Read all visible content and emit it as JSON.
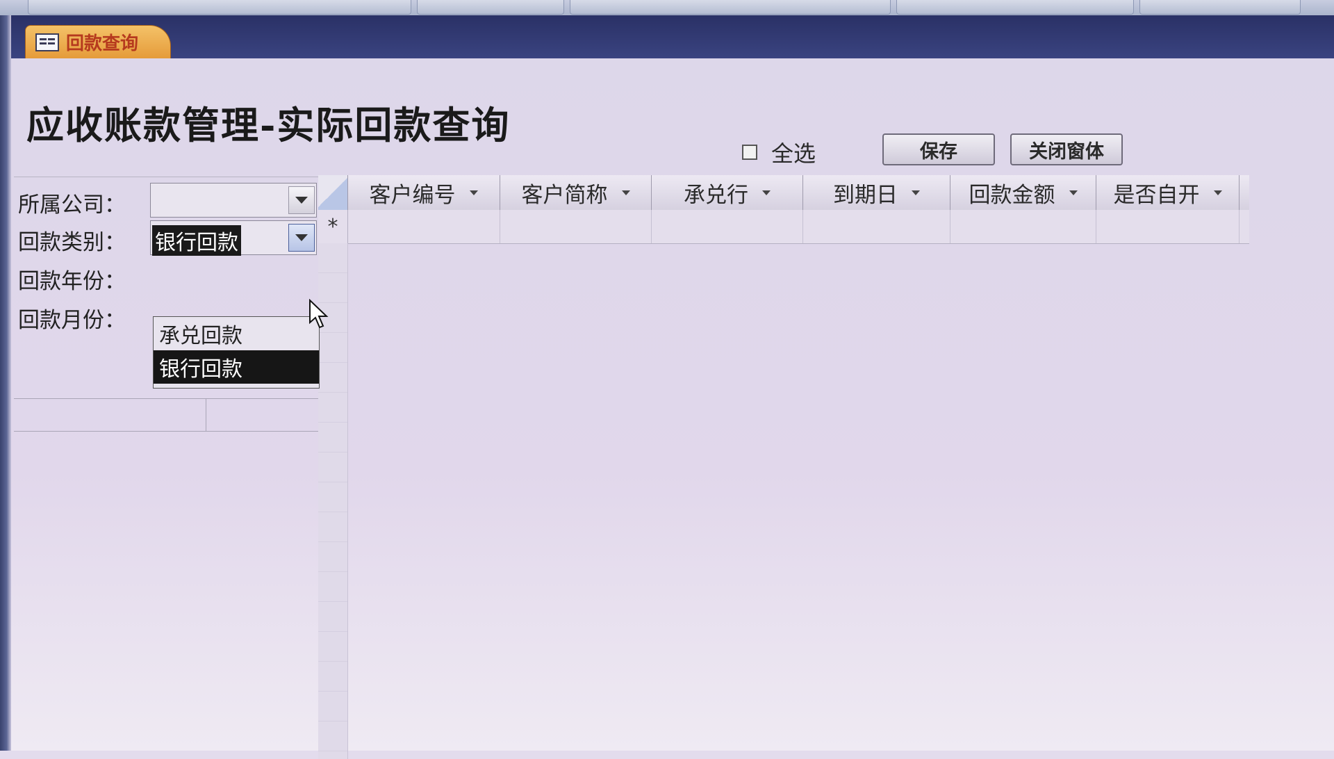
{
  "tab": {
    "label": "回款查询"
  },
  "page": {
    "title": "应收账款管理-实际回款查询"
  },
  "toolbar": {
    "select_all_label": "全选",
    "save_label": "保存",
    "close_label": "关闭窗体"
  },
  "filters": {
    "company_label": "所属公司：",
    "company_value": "",
    "type_label": "回款类别：",
    "type_value": "银行回款",
    "year_label": "回款年份：",
    "month_label": "回款月份："
  },
  "dropdown": {
    "options": [
      "承兑回款",
      "银行回款"
    ],
    "highlighted": "银行回款"
  },
  "grid": {
    "columns": [
      "客户编号",
      "客户简称",
      "承兑行",
      "到期日",
      "回款金额",
      "是否自开"
    ],
    "new_row_marker": "*"
  }
}
